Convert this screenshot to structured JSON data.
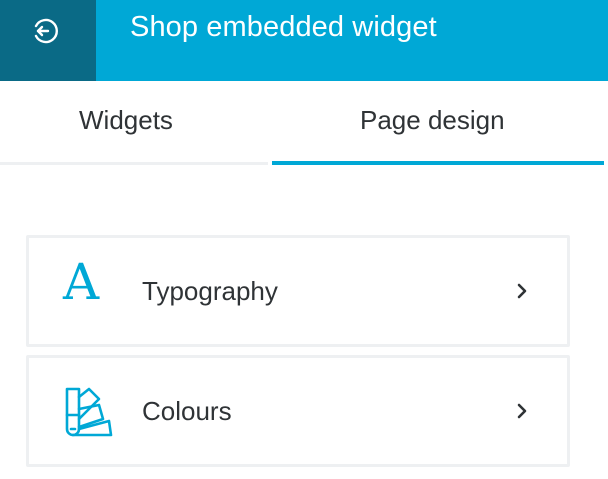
{
  "header": {
    "title": "Shop embedded widget",
    "back_icon": "back-arrow-icon",
    "background_color": "#00a8d6",
    "back_button_color": "#0a6a86"
  },
  "tabs": [
    {
      "label": "Widgets",
      "active": false
    },
    {
      "label": "Page design",
      "active": true
    }
  ],
  "cards": [
    {
      "label": "Typography",
      "icon": "typography-icon",
      "glyph": "A"
    },
    {
      "label": "Colours",
      "icon": "colour-swatch-icon"
    }
  ],
  "accent_color": "#00a8d6"
}
